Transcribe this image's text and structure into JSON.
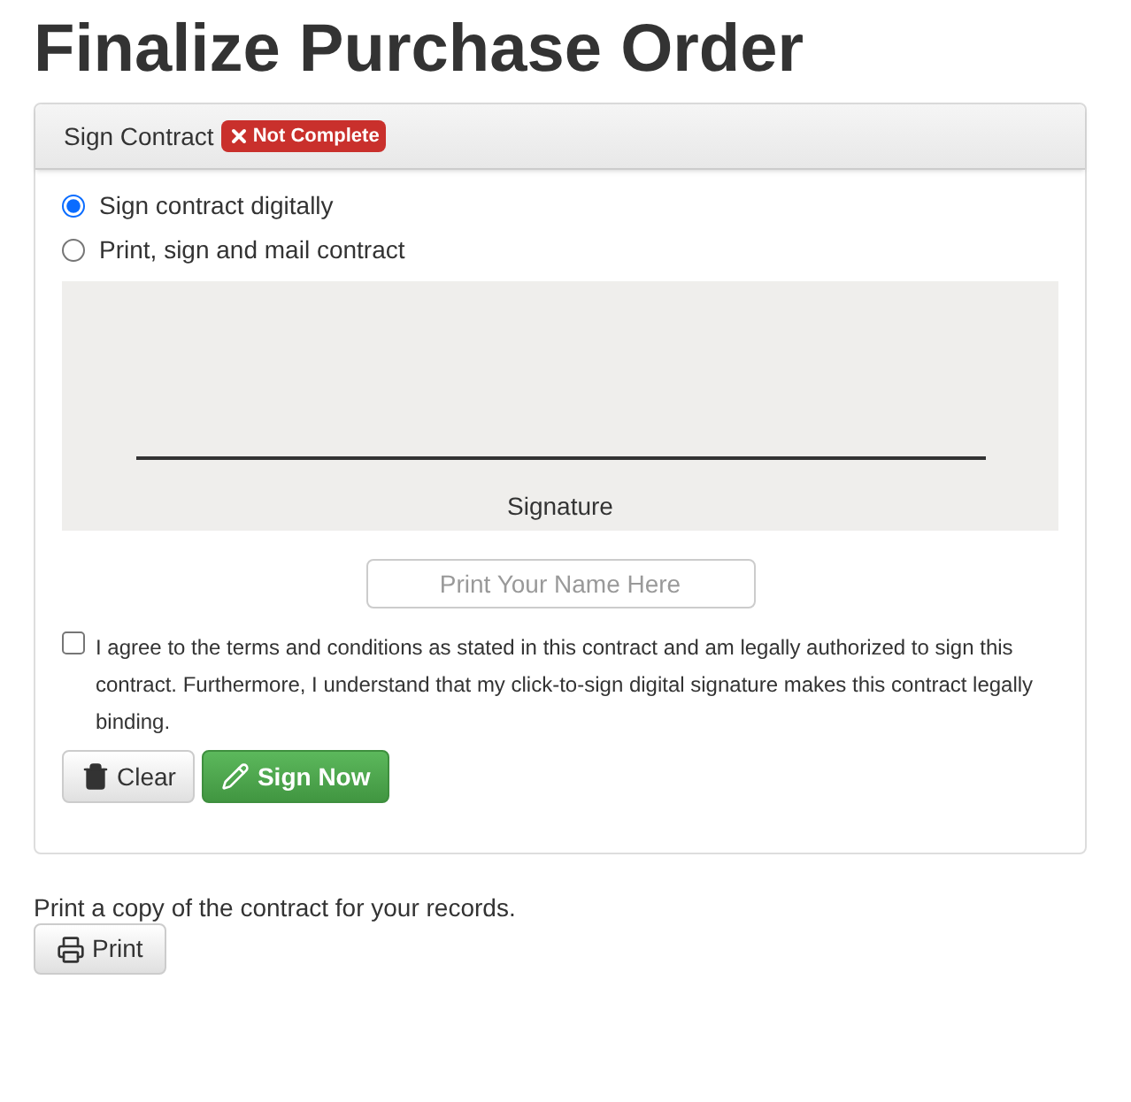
{
  "page": {
    "title": "Finalize Purchase Order"
  },
  "panel": {
    "title": "Sign Contract",
    "badge": {
      "label": "Not Complete",
      "kind": "error"
    }
  },
  "options": [
    {
      "label": "Sign contract digitally",
      "selected": true
    },
    {
      "label": "Print, sign and mail contract",
      "selected": false
    }
  ],
  "signature_pad": {
    "label": "Signature"
  },
  "name_field": {
    "placeholder": "Print Your Name Here"
  },
  "agreement": {
    "checked": false,
    "text": "I agree to the terms and conditions as stated in this contract and am legally authorized to sign this contract. Furthermore, I understand that my click-to-sign digital signature makes this contract legally binding."
  },
  "buttons": [
    {
      "label": "Clear",
      "kind": "default"
    },
    {
      "label": "Sign Now",
      "kind": "success"
    }
  ],
  "print_section": {
    "text": "Print a copy of the contract for your records.",
    "button": "Print"
  }
}
